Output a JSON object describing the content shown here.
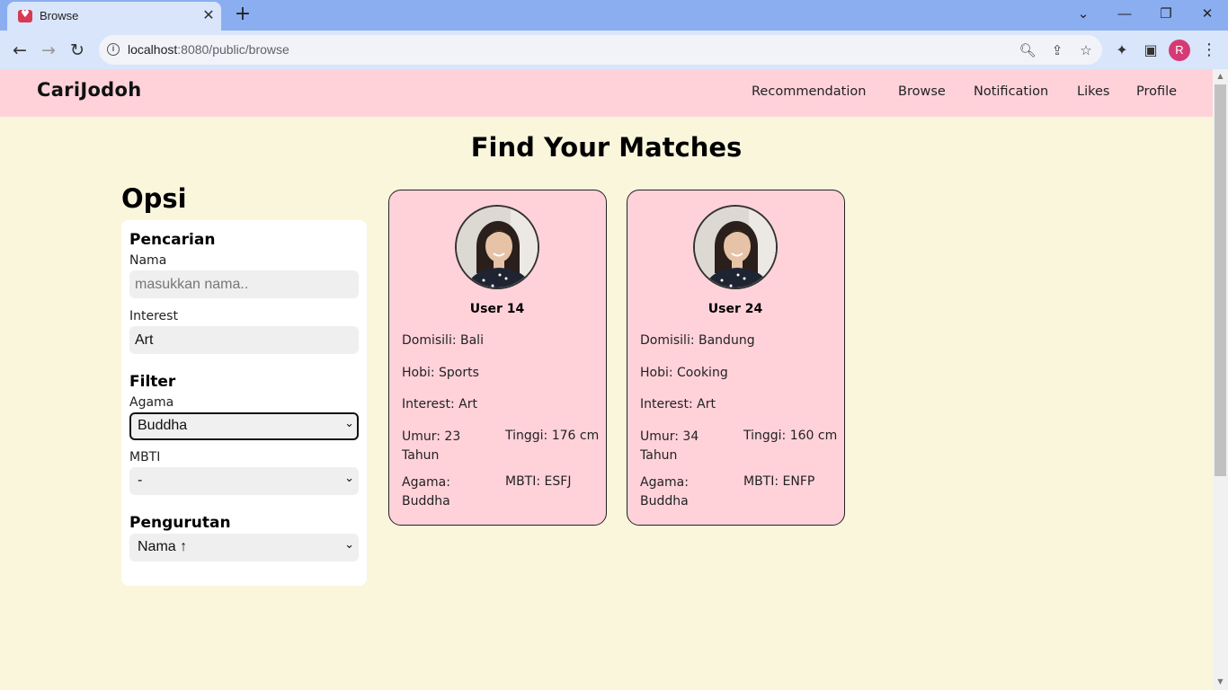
{
  "browser": {
    "tab_title": "Browse",
    "url_host": "localhost",
    "url_rest": ":8080/public/browse",
    "avatar_letter": "R"
  },
  "site": {
    "logo": "CariJodoh",
    "nav": [
      "Recommendation",
      "Browse",
      "Notification",
      "Likes",
      "Profile"
    ]
  },
  "page": {
    "title": "Find Your Matches"
  },
  "options": {
    "title": "Opsi",
    "search_title": "Pencarian",
    "name_label": "Nama",
    "name_placeholder": "masukkan nama..",
    "name_value": "",
    "interest_label": "Interest",
    "interest_value": "Art",
    "filter_title": "Filter",
    "agama_label": "Agama",
    "agama_value": "Buddha",
    "mbti_label": "MBTI",
    "mbti_value": "-",
    "sort_title": "Pengurutan",
    "sort_value": "Nama ↑"
  },
  "cards": [
    {
      "name": "User 14",
      "domisili": "Domisili: Bali",
      "hobi": "Hobi: Sports",
      "interest": "Interest: Art",
      "umur": "Umur: 23 Tahun",
      "tinggi": "Tinggi: 176 cm",
      "agama": "Agama: Buddha",
      "mbti": "MBTI: ESFJ"
    },
    {
      "name": "User 24",
      "domisili": "Domisili: Bandung",
      "hobi": "Hobi: Cooking",
      "interest": "Interest: Art",
      "umur": "Umur: 34 Tahun",
      "tinggi": "Tinggi: 160 cm",
      "agama": "Agama: Buddha",
      "mbti": "MBTI: ENFP"
    }
  ],
  "colors": {
    "page_bg": "#faf6dc",
    "nav_bg": "#ffd2da",
    "card_bg": "#ffd2da",
    "browser_tabbar": "#8aaef0",
    "browser_toolbar": "#d9e5fa"
  }
}
